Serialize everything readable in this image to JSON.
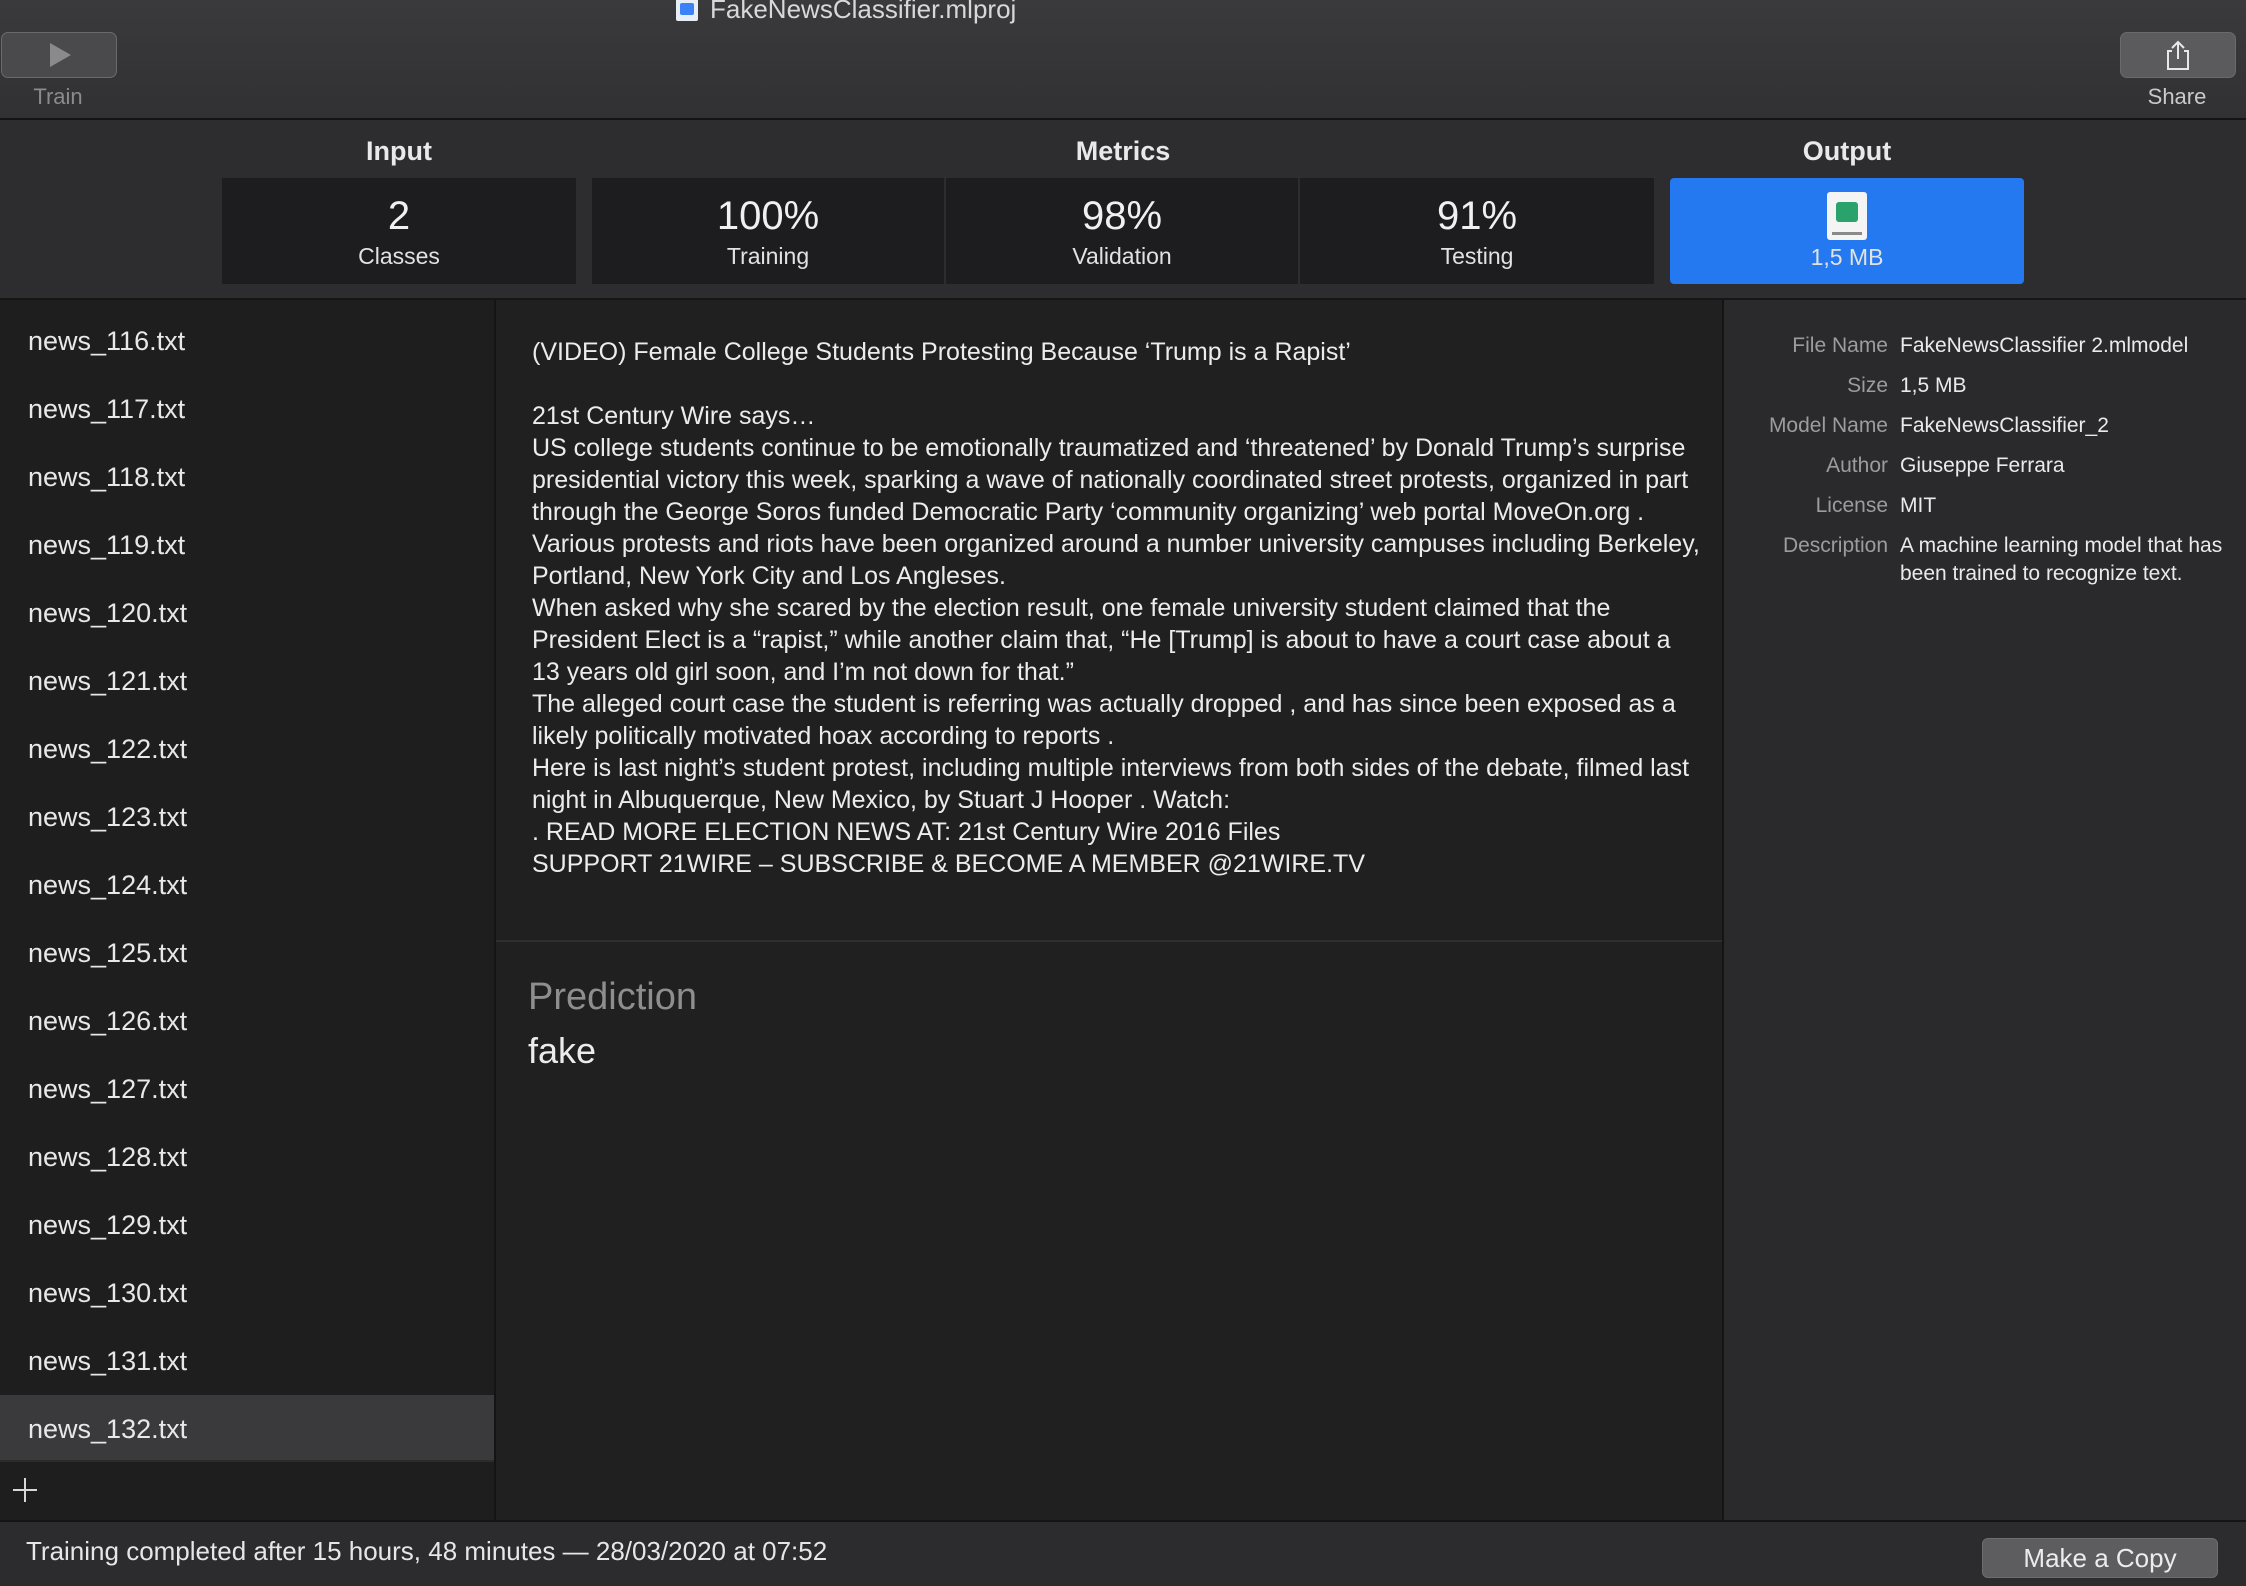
{
  "window": {
    "title": "FakeNewsClassifier.mlproj"
  },
  "toolbar": {
    "train_label": "Train",
    "share_label": "Share"
  },
  "header": {
    "input_label": "Input",
    "metrics_label": "Metrics",
    "output_label": "Output",
    "input": {
      "value": "2",
      "caption": "Classes"
    },
    "training": {
      "value": "100%",
      "caption": "Training"
    },
    "validation": {
      "value": "98%",
      "caption": "Validation"
    },
    "testing": {
      "value": "91%",
      "caption": "Testing"
    },
    "output": {
      "size": "1,5 MB",
      "icon": "mlmodel-file-icon"
    }
  },
  "sidebar": {
    "files": [
      "news_116.txt",
      "news_117.txt",
      "news_118.txt",
      "news_119.txt",
      "news_120.txt",
      "news_121.txt",
      "news_122.txt",
      "news_123.txt",
      "news_124.txt",
      "news_125.txt",
      "news_126.txt",
      "news_127.txt",
      "news_128.txt",
      "news_129.txt",
      "news_130.txt",
      "news_131.txt",
      "news_132.txt"
    ],
    "selected": "news_132.txt"
  },
  "article": {
    "title": "(VIDEO) Female College Students Protesting Because ‘Trump is a Rapist’",
    "lines": [
      "21st Century Wire says…",
      "US college students continue to be emotionally traumatized and ‘threatened’ by Donald Trump’s surprise presidential victory this week, sparking a wave of nationally coordinated street protests, organized in part through the George Soros funded Democratic Party ‘community organizing’ web portal MoveOn.org .",
      "Various protests and riots have been organized around a number university campuses including Berkeley, Portland, New York City and Los Angleses.",
      "When asked why she scared by the election result, one female university student claimed that the President Elect is a “rapist,” while another claim that, “He [Trump] is about to have a court case about a 13 years old girl soon, and I’m not down for that.”",
      "The alleged court case the student is referring was actually dropped , and has since been exposed as a likely politically motivated hoax according to reports .",
      "Here is last night’s student protest, including multiple interviews from both sides of the debate, filmed last night in Albuquerque, New Mexico, by Stuart J Hooper . Watch:",
      ". READ MORE ELECTION NEWS AT: 21st Century Wire 2016 Files",
      "SUPPORT 21WIRE – SUBSCRIBE & BECOME A MEMBER @21WIRE.TV"
    ]
  },
  "prediction": {
    "label": "Prediction",
    "value": "fake"
  },
  "metadata": [
    {
      "key": "File Name",
      "value": "FakeNewsClassifier 2.mlmodel"
    },
    {
      "key": "Size",
      "value": "1,5 MB"
    },
    {
      "key": "Model Name",
      "value": "FakeNewsClassifier_2"
    },
    {
      "key": "Author",
      "value": "Giuseppe Ferrara"
    },
    {
      "key": "License",
      "value": "MIT"
    },
    {
      "key": "Description",
      "value": "A machine learning model that has been trained to recognize text."
    }
  ],
  "status": {
    "text": "Training completed after 15 hours, 48 minutes — 28/03/2020 at 07:52",
    "copy_button": "Make a Copy"
  }
}
